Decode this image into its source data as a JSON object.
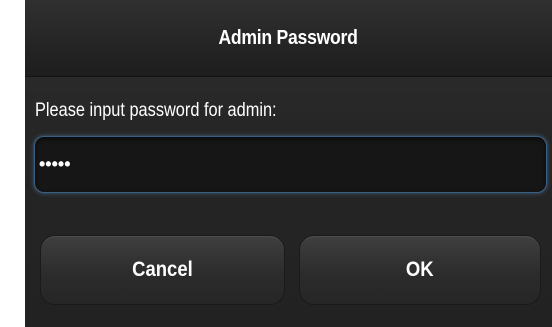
{
  "dialog": {
    "title": "Admin Password",
    "prompt": "Please input password for admin:",
    "password_value": "•••••",
    "cancel_label": "Cancel",
    "ok_label": "OK"
  }
}
